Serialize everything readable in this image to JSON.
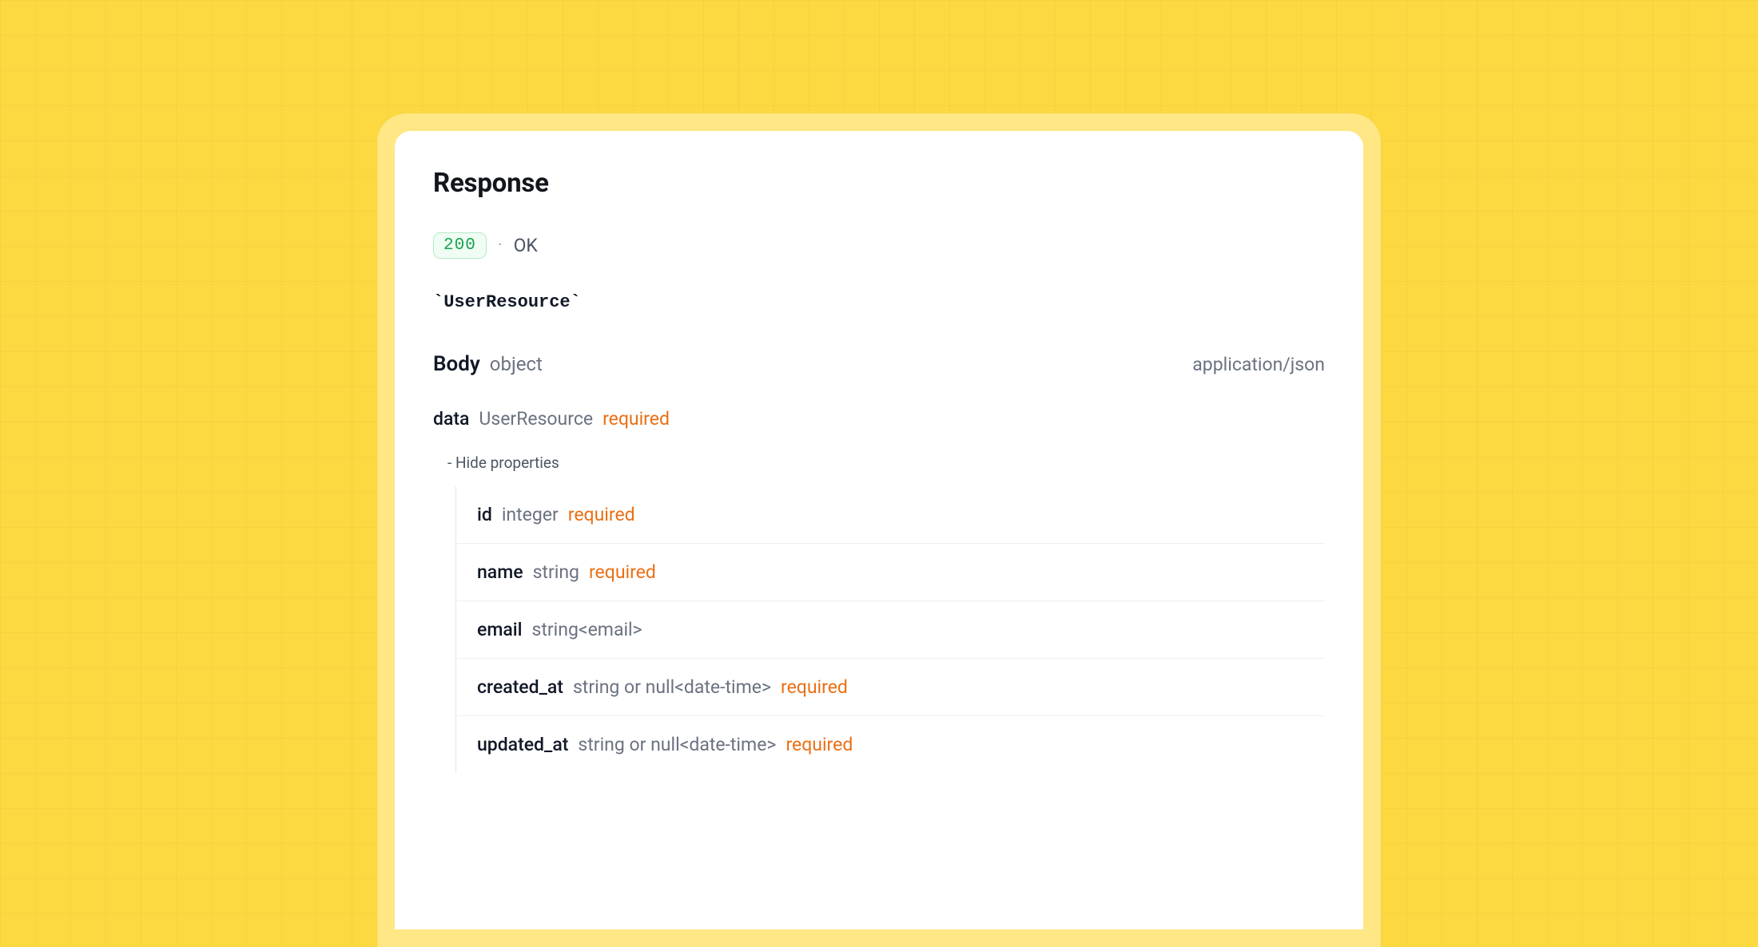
{
  "response": {
    "title": "Response",
    "status_code": "200",
    "status_text": "OK",
    "resource_name": "`UserResource`",
    "body_label": "Body",
    "body_type": "object",
    "content_type": "application/json",
    "data": {
      "name": "data",
      "type": "UserResource",
      "required_label": "required",
      "toggle_label": "- Hide properties",
      "properties": [
        {
          "name": "id",
          "type": "integer",
          "required": true
        },
        {
          "name": "name",
          "type": "string",
          "required": true
        },
        {
          "name": "email",
          "type": "string<email>",
          "required": false
        },
        {
          "name": "created_at",
          "type": "string or null<date-time>",
          "required": true
        },
        {
          "name": "updated_at",
          "type": "string or null<date-time>",
          "required": true
        }
      ]
    },
    "required_word": "required"
  }
}
